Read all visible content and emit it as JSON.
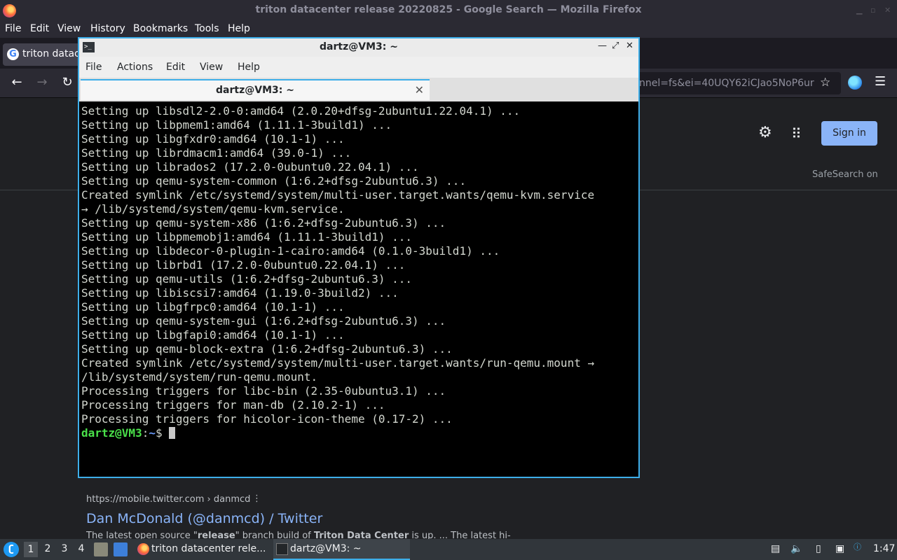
{
  "firefox": {
    "window_title": "triton datacenter release 20220825 - Google Search — Mozilla Firefox",
    "menu": [
      "File",
      "Edit",
      "View",
      "History",
      "Bookmarks",
      "Tools",
      "Help"
    ],
    "tab_label": "triton datac",
    "url_fragment": "nnel=fs&ei=40UQY62iCJao5NoP6ur"
  },
  "google": {
    "sign_in": "Sign in",
    "safesearch": "SafeSearch on",
    "result": {
      "url": "https://mobile.twitter.com › danmcd",
      "title": "Dan McDonald (@danmcd) / Twitter",
      "snippet_pre": "The latest open source \"",
      "snippet_b1": "release",
      "snippet_mid": "\" branch build of ",
      "snippet_b2": "Triton Data Center",
      "snippet_post": " is up. ... The latest hi-"
    }
  },
  "terminal": {
    "window_title": "dartz@VM3: ~",
    "menu": [
      "File",
      "Actions",
      "Edit",
      "View",
      "Help"
    ],
    "tab_label": "dartz@VM3: ~",
    "lines": [
      "Setting up libsdl2-2.0-0:amd64 (2.0.20+dfsg-2ubuntu1.22.04.1) ...",
      "Setting up libpmem1:amd64 (1.11.1-3build1) ...",
      "Setting up libgfxdr0:amd64 (10.1-1) ...",
      "Setting up librdmacm1:amd64 (39.0-1) ...",
      "Setting up librados2 (17.2.0-0ubuntu0.22.04.1) ...",
      "Setting up qemu-system-common (1:6.2+dfsg-2ubuntu6.3) ...",
      "Created symlink /etc/systemd/system/multi-user.target.wants/qemu-kvm.service",
      "→ /lib/systemd/system/qemu-kvm.service.",
      "Setting up qemu-system-x86 (1:6.2+dfsg-2ubuntu6.3) ...",
      "Setting up libpmemobj1:amd64 (1.11.1-3build1) ...",
      "Setting up libdecor-0-plugin-1-cairo:amd64 (0.1.0-3build1) ...",
      "Setting up librbd1 (17.2.0-0ubuntu0.22.04.1) ...",
      "Setting up qemu-utils (1:6.2+dfsg-2ubuntu6.3) ...",
      "Setting up libiscsi7:amd64 (1.19.0-3build2) ...",
      "Setting up libgfrpc0:amd64 (10.1-1) ...",
      "Setting up qemu-system-gui (1:6.2+dfsg-2ubuntu6.3) ...",
      "Setting up libgfapi0:amd64 (10.1-1) ...",
      "Setting up qemu-block-extra (1:6.2+dfsg-2ubuntu6.3) ...",
      "Created symlink /etc/systemd/system/multi-user.target.wants/run-qemu.mount →",
      "/lib/systemd/system/run-qemu.mount.",
      "Processing triggers for libc-bin (2.35-0ubuntu3.1) ...",
      "Processing triggers for man-db (2.10.2-1) ...",
      "Processing triggers for hicolor-icon-theme (0.17-2) ..."
    ],
    "prompt_user": "dartz@VM3",
    "prompt_sep": ":",
    "prompt_path": "~",
    "prompt_symbol": "$ "
  },
  "taskbar": {
    "workspaces": [
      "1",
      "2",
      "3",
      "4"
    ],
    "tasks": [
      {
        "label": "triton datacenter rele..."
      },
      {
        "label": "dartz@VM3: ~"
      }
    ],
    "clock": "1:47"
  }
}
